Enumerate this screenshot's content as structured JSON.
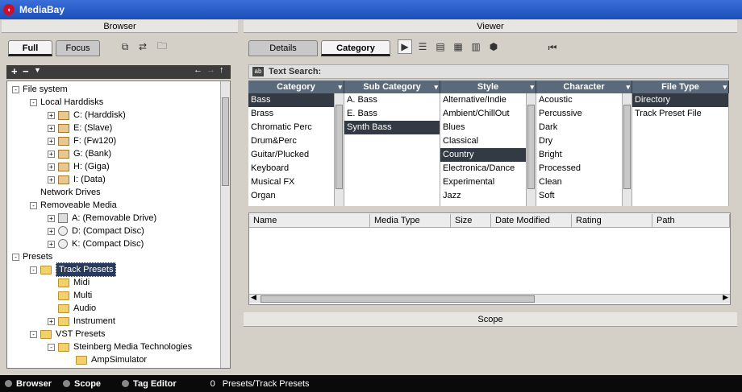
{
  "window": {
    "title": "MediaBay"
  },
  "browser": {
    "header": "Browser",
    "tab_full": "Full",
    "tab_focus": "Focus",
    "tree": [
      {
        "label": "File system",
        "level": 0,
        "exp": "-",
        "icon": "none"
      },
      {
        "label": "Local Harddisks",
        "level": 1,
        "exp": "-",
        "icon": "none"
      },
      {
        "label": "C: (Harddisk)",
        "level": 2,
        "exp": "+",
        "icon": "drive"
      },
      {
        "label": "E: (Slave)",
        "level": 2,
        "exp": "+",
        "icon": "drive"
      },
      {
        "label": "F: (Fw120)",
        "level": 2,
        "exp": "+",
        "icon": "drive"
      },
      {
        "label": "G: (Bank)",
        "level": 2,
        "exp": "+",
        "icon": "drive"
      },
      {
        "label": "H: (Giga)",
        "level": 2,
        "exp": "+",
        "icon": "drive"
      },
      {
        "label": "I: (Data)",
        "level": 2,
        "exp": "+",
        "icon": "drive"
      },
      {
        "label": "Network Drives",
        "level": 1,
        "exp": "",
        "icon": "none"
      },
      {
        "label": "Removeable Media",
        "level": 1,
        "exp": "-",
        "icon": "none"
      },
      {
        "label": "A: (Removable Drive)",
        "level": 2,
        "exp": "+",
        "icon": "remov"
      },
      {
        "label": "D: (Compact Disc)",
        "level": 2,
        "exp": "+",
        "icon": "disc"
      },
      {
        "label": "K: (Compact Disc)",
        "level": 2,
        "exp": "+",
        "icon": "disc"
      },
      {
        "label": "Presets",
        "level": 0,
        "exp": "-",
        "icon": "none"
      },
      {
        "label": "Track Presets",
        "level": 1,
        "exp": "-",
        "icon": "fold",
        "sel": true
      },
      {
        "label": "Midi",
        "level": 2,
        "exp": "",
        "icon": "fold"
      },
      {
        "label": "Multi",
        "level": 2,
        "exp": "",
        "icon": "fold"
      },
      {
        "label": "Audio",
        "level": 2,
        "exp": "",
        "icon": "fold"
      },
      {
        "label": "Instrument",
        "level": 2,
        "exp": "+",
        "icon": "fold"
      },
      {
        "label": "VST Presets",
        "level": 1,
        "exp": "-",
        "icon": "fold"
      },
      {
        "label": "Steinberg Media Technologies",
        "level": 2,
        "exp": "-",
        "icon": "fold"
      },
      {
        "label": "AmpSimulator",
        "level": 3,
        "exp": "",
        "icon": "fold"
      }
    ]
  },
  "viewer": {
    "header": "Viewer",
    "tab_details": "Details",
    "tab_category": "Category",
    "text_search_label": "Text Search:"
  },
  "filters": [
    {
      "title": "Category",
      "items": [
        "Bass",
        "Brass",
        "Chromatic Perc",
        "Drum&Perc",
        "Guitar/Plucked",
        "Keyboard",
        "Musical FX",
        "Organ"
      ],
      "selected": 0
    },
    {
      "title": "Sub Category",
      "items": [
        "A. Bass",
        "E. Bass",
        "Synth Bass"
      ],
      "selected": 2
    },
    {
      "title": "Style",
      "items": [
        "Alternative/Indie",
        "Ambient/ChillOut",
        "Blues",
        "Classical",
        "Country",
        "Electronica/Dance",
        "Experimental",
        "Jazz"
      ],
      "selected": 4
    },
    {
      "title": "Character",
      "items": [
        "Acoustic",
        "Percussive",
        "Dark",
        "Dry",
        "Bright",
        "Processed",
        "Clean",
        "Soft"
      ],
      "selected": -1
    },
    {
      "title": "File Type",
      "items": [
        "Directory",
        "Track Preset File"
      ],
      "selected": 0
    }
  ],
  "results": {
    "columns": [
      "Name",
      "Media Type",
      "Size",
      "Date Modified",
      "Rating",
      "Path"
    ]
  },
  "scope": {
    "header": "Scope"
  },
  "status": {
    "browser": "Browser",
    "scope": "Scope",
    "tag_editor": "Tag Editor",
    "count": "0",
    "path": "Presets/Track Presets"
  }
}
